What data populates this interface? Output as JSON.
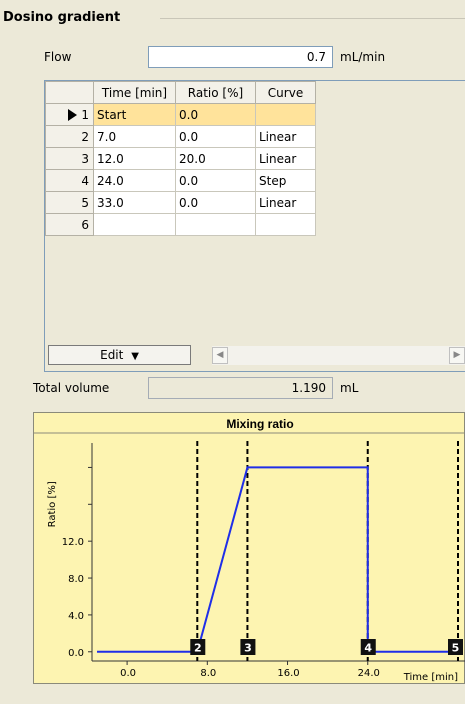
{
  "section": {
    "title": "Dosino gradient"
  },
  "flow": {
    "label": "Flow",
    "value": "0.7",
    "unit": "mL/min"
  },
  "table": {
    "columns": [
      "",
      "Time [min]",
      "Ratio [%]",
      "Curve"
    ],
    "rows": [
      {
        "num": "1",
        "time": "Start",
        "ratio": "0.0",
        "curve": "",
        "selected": true
      },
      {
        "num": "2",
        "time": "7.0",
        "ratio": "0.0",
        "curve": "Linear"
      },
      {
        "num": "3",
        "time": "12.0",
        "ratio": "20.0",
        "curve": "Linear"
      },
      {
        "num": "4",
        "time": "24.0",
        "ratio": "0.0",
        "curve": "Step"
      },
      {
        "num": "5",
        "time": "33.0",
        "ratio": "0.0",
        "curve": "Linear"
      },
      {
        "num": "6",
        "time": "",
        "ratio": "",
        "curve": ""
      }
    ]
  },
  "edit_button": {
    "label": "Edit",
    "icon": "triangle-down-icon"
  },
  "total_volume": {
    "label": "Total volume",
    "value": "1.190",
    "unit": "mL"
  },
  "colors": {
    "chart_bg": "#fdf4b1",
    "line": "#1f2ee8",
    "marker_bg": "#111111",
    "selected_row": "#ffe39b"
  },
  "chart_data": {
    "type": "line",
    "title": "Mixing ratio",
    "xlabel": "Time [min]",
    "ylabel": "Ratio [%]",
    "xlim": [
      -3.5,
      33
    ],
    "ylim": [
      -1,
      22
    ],
    "x_ticks": [
      "0.0",
      "8.0",
      "16.0",
      "24.0"
    ],
    "y_ticks": [
      "0.0",
      "4.0",
      "8.0",
      "12.0"
    ],
    "series": [
      {
        "x": [
          -3,
          7,
          12,
          24,
          24,
          33
        ],
        "y": [
          0,
          0,
          20,
          20,
          0,
          0
        ]
      }
    ],
    "markers": [
      {
        "label": "2",
        "x": 7
      },
      {
        "label": "3",
        "x": 12
      },
      {
        "label": "4",
        "x": 24
      },
      {
        "label": "5",
        "x": 33
      }
    ]
  }
}
